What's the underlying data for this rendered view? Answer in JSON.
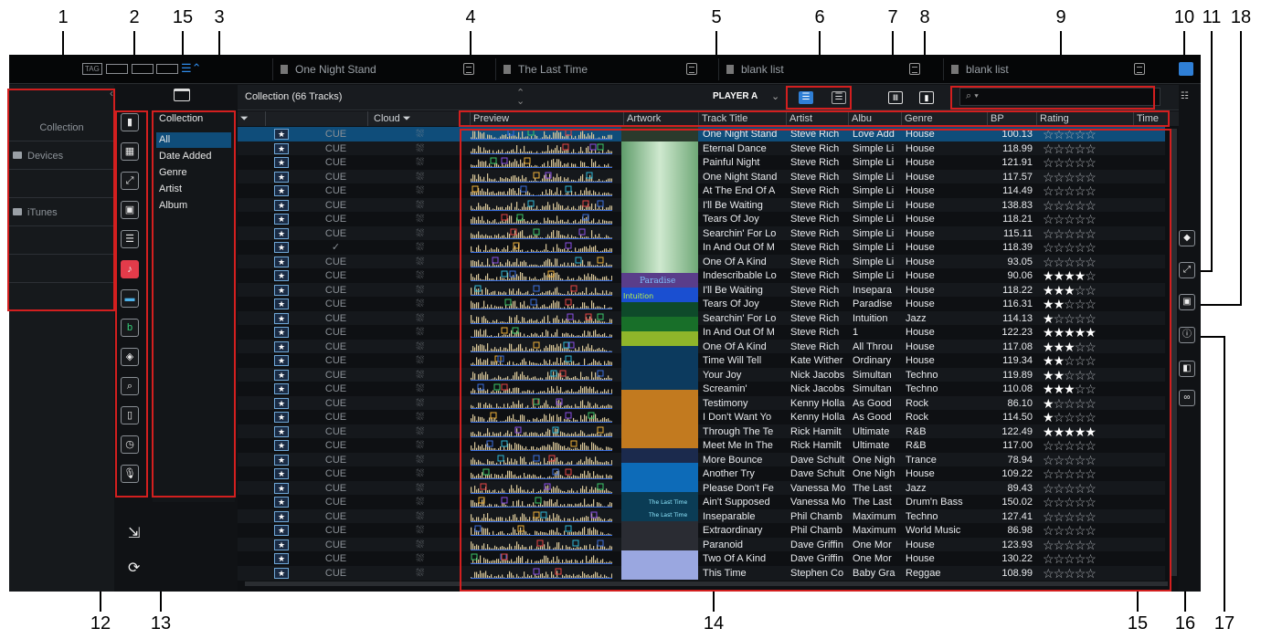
{
  "callouts": {
    "top": [
      "1",
      "2",
      "15",
      "3",
      "4",
      "5",
      "6",
      "7",
      "8",
      "9",
      "10",
      "11",
      "18"
    ],
    "bottom": [
      "12",
      "13",
      "14",
      "15",
      "16",
      "17"
    ]
  },
  "topbar": {
    "tag_label": "TAG",
    "tabs": [
      {
        "label": "One Night Stand"
      },
      {
        "label": "The Last Time"
      },
      {
        "label": "blank list"
      },
      {
        "label": "blank list"
      }
    ]
  },
  "tree": {
    "items": [
      {
        "label": "Collection",
        "folder": false
      },
      {
        "label": "Devices",
        "folder": true
      },
      {
        "label": "",
        "folder": false
      },
      {
        "label": "iTunes",
        "folder": true
      },
      {
        "label": "",
        "folder": false
      },
      {
        "label": "",
        "folder": false
      },
      {
        "label": "",
        "folder": false
      }
    ]
  },
  "browser": {
    "title": "Collection",
    "items": [
      "All",
      "Date Added",
      "Genre",
      "Artist",
      "Album"
    ],
    "selected": "All"
  },
  "list": {
    "title": "Collection (66 Tracks)",
    "player": "PLAYER A",
    "search_placeholder": "",
    "columns": [
      "Cloud",
      "Preview",
      "Artwork",
      "Track Title",
      "Artist",
      "Albu",
      "Genre",
      "BP",
      "Rating",
      "Time"
    ]
  },
  "tracks": [
    {
      "cue": "CUE",
      "title": "One Night Stand",
      "artist": "Steve Rich",
      "album": "Love Add",
      "genre": "House",
      "bpm": "100.13",
      "rating": 0
    },
    {
      "cue": "CUE",
      "title": "Eternal Dance",
      "artist": "Steve Rich",
      "album": "Simple Li",
      "genre": "House",
      "bpm": "118.99",
      "rating": 0
    },
    {
      "cue": "CUE",
      "title": "Painful Night",
      "artist": "Steve Rich",
      "album": "Simple Li",
      "genre": "House",
      "bpm": "121.91",
      "rating": 0
    },
    {
      "cue": "CUE",
      "title": "One Night Stand",
      "artist": "Steve Rich",
      "album": "Simple Li",
      "genre": "House",
      "bpm": "117.57",
      "rating": 0
    },
    {
      "cue": "CUE",
      "title": "At The End Of A",
      "artist": "Steve Rich",
      "album": "Simple Li",
      "genre": "House",
      "bpm": "114.49",
      "rating": 0
    },
    {
      "cue": "CUE",
      "title": "I'll Be Waiting",
      "artist": "Steve Rich",
      "album": "Simple Li",
      "genre": "House",
      "bpm": "138.83",
      "rating": 0
    },
    {
      "cue": "CUE",
      "title": "Tears Of Joy",
      "artist": "Steve Rich",
      "album": "Simple Li",
      "genre": "House",
      "bpm": "118.21",
      "rating": 0
    },
    {
      "cue": "CUE",
      "title": "Searchin' For Lo",
      "artist": "Steve Rich",
      "album": "Simple Li",
      "genre": "House",
      "bpm": "115.11",
      "rating": 0
    },
    {
      "cue": "✓",
      "title": "In And Out Of M",
      "artist": "Steve Rich",
      "album": "Simple Li",
      "genre": "House",
      "bpm": "118.39",
      "rating": 0
    },
    {
      "cue": "CUE",
      "title": "One Of A Kind",
      "artist": "Steve Rich",
      "album": "Simple Li",
      "genre": "House",
      "bpm": "93.05",
      "rating": 0
    },
    {
      "cue": "CUE",
      "title": "Indescribable Lo",
      "artist": "Steve Rich",
      "album": "Simple Li",
      "genre": "House",
      "bpm": "90.06",
      "rating": 4
    },
    {
      "cue": "CUE",
      "title": "I'll Be Waiting",
      "artist": "Steve Rich",
      "album": "Insepara",
      "genre": "House",
      "bpm": "118.22",
      "rating": 3
    },
    {
      "cue": "CUE",
      "title": "Tears Of Joy",
      "artist": "Steve Rich",
      "album": "Paradise",
      "genre": "House",
      "bpm": "116.31",
      "rating": 2
    },
    {
      "cue": "CUE",
      "title": "Searchin' For Lo",
      "artist": "Steve Rich",
      "album": "Intuition",
      "genre": "Jazz",
      "bpm": "114.13",
      "rating": 1
    },
    {
      "cue": "CUE",
      "title": "In And Out Of M",
      "artist": "Steve Rich",
      "album": "1",
      "genre": "House",
      "bpm": "122.23",
      "rating": 5
    },
    {
      "cue": "CUE",
      "title": "One Of A Kind",
      "artist": "Steve Rich",
      "album": "All Throu",
      "genre": "House",
      "bpm": "117.08",
      "rating": 3
    },
    {
      "cue": "CUE",
      "title": "Time Will Tell",
      "artist": "Kate Wither",
      "album": "Ordinary",
      "genre": "House",
      "bpm": "119.34",
      "rating": 2
    },
    {
      "cue": "CUE",
      "title": "Your Joy",
      "artist": "Nick Jacobs",
      "album": "Simultan",
      "genre": "Techno",
      "bpm": "119.89",
      "rating": 2
    },
    {
      "cue": "CUE",
      "title": "Screamin'",
      "artist": "Nick Jacobs",
      "album": "Simultan",
      "genre": "Techno",
      "bpm": "110.08",
      "rating": 3
    },
    {
      "cue": "CUE",
      "title": "Testimony",
      "artist": "Kenny Holla",
      "album": "As Good",
      "genre": "Rock",
      "bpm": "86.10",
      "rating": 1
    },
    {
      "cue": "CUE",
      "title": "I Don't Want Yo",
      "artist": "Kenny Holla",
      "album": "As Good",
      "genre": "Rock",
      "bpm": "114.50",
      "rating": 1
    },
    {
      "cue": "CUE",
      "title": "Through The Te",
      "artist": "Rick Hamilt",
      "album": "Ultimate",
      "genre": "R&B",
      "bpm": "122.49",
      "rating": 5
    },
    {
      "cue": "CUE",
      "title": "Meet Me In The",
      "artist": "Rick Hamilt",
      "album": "Ultimate",
      "genre": "R&B",
      "bpm": "117.00",
      "rating": 0
    },
    {
      "cue": "CUE",
      "title": "More Bounce",
      "artist": "Dave Schult",
      "album": "One Nigh",
      "genre": "Trance",
      "bpm": "78.94",
      "rating": 0
    },
    {
      "cue": "CUE",
      "title": "Another Try",
      "artist": "Dave Schult",
      "album": "One Nigh",
      "genre": "House",
      "bpm": "109.22",
      "rating": 0
    },
    {
      "cue": "CUE",
      "title": "Please Don't Fe",
      "artist": "Vanessa Mo",
      "album": "The Last",
      "genre": "Jazz",
      "bpm": "89.43",
      "rating": 0
    },
    {
      "cue": "CUE",
      "title": "Ain't Supposed",
      "artist": "Vanessa Mo",
      "album": "The Last",
      "genre": "Drum'n Bass",
      "bpm": "150.02",
      "rating": 0
    },
    {
      "cue": "CUE",
      "title": "Inseparable",
      "artist": "Phil Chamb",
      "album": "Maximum",
      "genre": "Techno",
      "bpm": "127.41",
      "rating": 0
    },
    {
      "cue": "CUE",
      "title": "Extraordinary",
      "artist": "Phil Chamb",
      "album": "Maximum",
      "genre": "World Music",
      "bpm": "86.98",
      "rating": 0
    },
    {
      "cue": "CUE",
      "title": "Paranoid",
      "artist": "Dave Griffin",
      "album": "One Mor",
      "genre": "House",
      "bpm": "123.93",
      "rating": 0
    },
    {
      "cue": "CUE",
      "title": "Two Of A Kind",
      "artist": "Dave Griffin",
      "album": "One Mor",
      "genre": "House",
      "bpm": "130.22",
      "rating": 0
    },
    {
      "cue": "CUE",
      "title": "This Time",
      "artist": "Stephen Co",
      "album": "Baby Gra",
      "genre": "Reggae",
      "bpm": "108.99",
      "rating": 0
    }
  ],
  "artwork_labels": [
    "Paradise",
    "Intuition",
    "The Last Time",
    "The Last Time"
  ],
  "colors": {
    "background": "#0e1013",
    "accent_blue": "#2f7fd6",
    "selection": "#0f4d7a",
    "callout_red": "#d31f1f"
  }
}
